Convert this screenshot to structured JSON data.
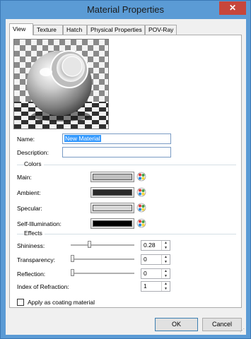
{
  "window": {
    "title": "Material Properties",
    "close_glyph": "✕"
  },
  "tabs": [
    {
      "label": "View",
      "active": true
    },
    {
      "label": "Texture",
      "active": false
    },
    {
      "label": "Hatch",
      "active": false
    },
    {
      "label": "Physical Properties",
      "active": false
    },
    {
      "label": "POV-Ray",
      "active": false
    }
  ],
  "preview": {
    "icon": "sphere-preview"
  },
  "name": {
    "label": "Name:",
    "value": "New Material"
  },
  "description": {
    "label": "Description:",
    "value": ""
  },
  "colors": {
    "title": "Colors",
    "main": {
      "label": "Main:",
      "color": "#c0c0c0"
    },
    "ambient": {
      "label": "Ambient:",
      "color": "#2a2a2a"
    },
    "specular": {
      "label": "Specular:",
      "color": "#d6d6d6"
    },
    "self_illumination": {
      "label": "Self-Illumination:",
      "color": "#000000"
    },
    "palette_icon": "color-palette-icon"
  },
  "effects": {
    "title": "Effects",
    "shininess": {
      "label": "Shininess:",
      "value": "0.28",
      "level": 0.28
    },
    "transparency": {
      "label": "Transparency:",
      "value": "0",
      "level": 0
    },
    "reflection": {
      "label": "Reflection:",
      "value": "0",
      "level": 0
    },
    "index_of_refraction": {
      "label": "Index of Refraction:",
      "value": "1"
    }
  },
  "coating": {
    "label": "Apply as coating material",
    "checked": false
  },
  "buttons": {
    "ok": "OK",
    "cancel": "Cancel"
  }
}
